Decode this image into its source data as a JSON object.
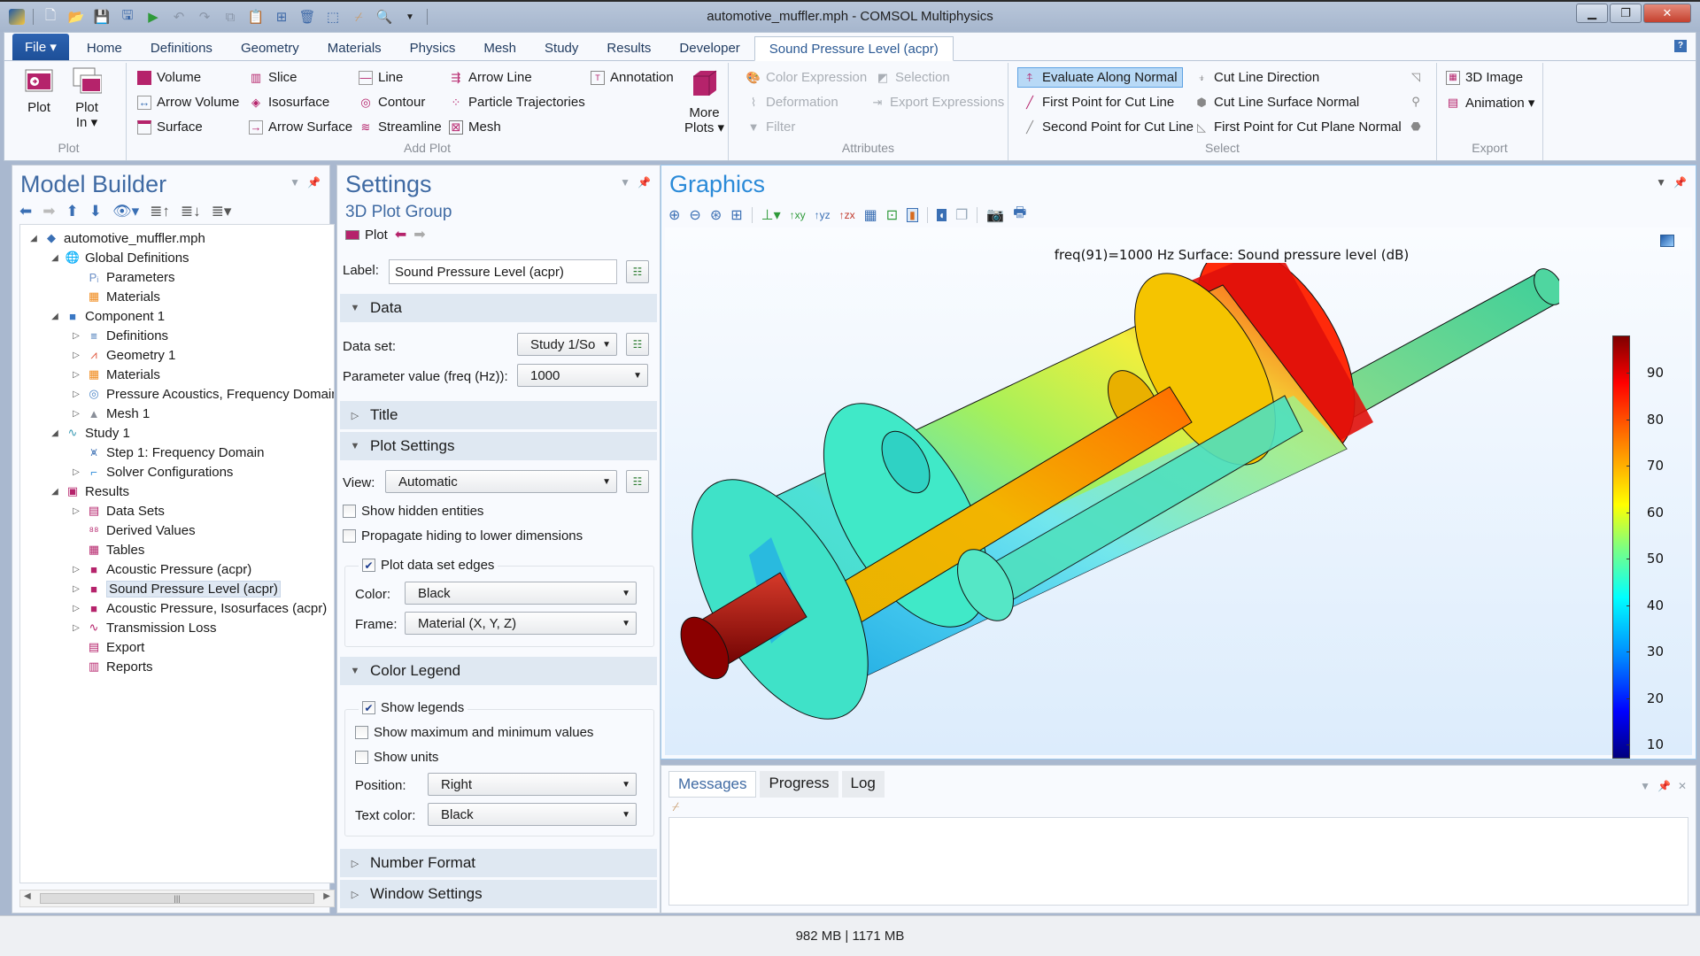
{
  "window": {
    "title": "automotive_muffler.mph - COMSOL Multiphysics",
    "controls": [
      "minimize",
      "maximize",
      "close"
    ]
  },
  "quick_access": [
    "app-logo-icon",
    "new-file-icon",
    "open-folder-icon",
    "save-icon",
    "save-as-icon",
    "run-icon",
    "undo-icon",
    "redo-icon",
    "copy-icon",
    "paste-icon",
    "duplicate-icon",
    "delete-icon",
    "select-icon",
    "clear-selection-icon",
    "find-icon",
    "customize-dropdown-icon"
  ],
  "ribbon": {
    "tabs": [
      "File",
      "Home",
      "Definitions",
      "Geometry",
      "Materials",
      "Physics",
      "Mesh",
      "Study",
      "Results",
      "Developer",
      "Sound Pressure Level (acpr)"
    ],
    "active_tab": "Sound Pressure Level (acpr)",
    "groups": {
      "plot": {
        "label": "Plot",
        "plot": "Plot",
        "plot_in_1": "Plot",
        "plot_in_2": "In ▾"
      },
      "add_plot": {
        "label": "Add Plot",
        "items": [
          "Volume",
          "Arrow Volume",
          "Surface",
          "Slice",
          "Isosurface",
          "Arrow Surface",
          "Line",
          "Contour",
          "Streamline",
          "Arrow Line",
          "Particle Trajectories",
          "Mesh",
          "Annotation"
        ],
        "more_plots_1": "More",
        "more_plots_2": "Plots ▾"
      },
      "attributes": {
        "label": "Attributes",
        "items": [
          "Color Expression",
          "Deformation",
          "Filter",
          "Selection",
          "Export Expressions"
        ]
      },
      "select": {
        "label": "Select",
        "items": [
          "Evaluate Along Normal",
          "First Point for Cut Line",
          "Second Point for Cut Line",
          "Cut Line Direction",
          "Cut Line Surface Normal",
          "First Point for Cut Plane Normal"
        ],
        "selected": "Evaluate Along Normal"
      },
      "export": {
        "label": "Export",
        "items": [
          "3D Image",
          "Animation ▾"
        ]
      }
    }
  },
  "model_builder": {
    "title": "Model Builder",
    "tree": [
      {
        "label": "automotive_muffler.mph",
        "level": 0,
        "toggle": "expanded",
        "icon": "model-icon"
      },
      {
        "label": "Global Definitions",
        "level": 1,
        "toggle": "expanded",
        "icon": "globe-icon"
      },
      {
        "label": "Parameters",
        "level": 2,
        "toggle": "none",
        "icon": "parameters-icon"
      },
      {
        "label": "Materials",
        "level": 2,
        "toggle": "none",
        "icon": "materials-icon"
      },
      {
        "label": "Component 1",
        "level": 1,
        "toggle": "expanded",
        "icon": "component-icon"
      },
      {
        "label": "Definitions",
        "level": 2,
        "toggle": "collapsed",
        "icon": "definitions-icon"
      },
      {
        "label": "Geometry 1",
        "level": 2,
        "toggle": "collapsed",
        "icon": "geometry-icon"
      },
      {
        "label": "Materials",
        "level": 2,
        "toggle": "collapsed",
        "icon": "materials-icon"
      },
      {
        "label": "Pressure Acoustics, Frequency Domain",
        "level": 2,
        "toggle": "collapsed",
        "icon": "acoustics-icon"
      },
      {
        "label": "Mesh 1",
        "level": 2,
        "toggle": "collapsed",
        "icon": "mesh-icon"
      },
      {
        "label": "Study 1",
        "level": 1,
        "toggle": "expanded",
        "icon": "study-icon"
      },
      {
        "label": "Step 1: Frequency Domain",
        "level": 2,
        "toggle": "none",
        "icon": "frequency-step-icon"
      },
      {
        "label": "Solver Configurations",
        "level": 2,
        "toggle": "collapsed",
        "icon": "solver-icon"
      },
      {
        "label": "Results",
        "level": 1,
        "toggle": "expanded",
        "icon": "results-icon"
      },
      {
        "label": "Data Sets",
        "level": 2,
        "toggle": "collapsed",
        "icon": "datasets-icon"
      },
      {
        "label": "Derived Values",
        "level": 2,
        "toggle": "none",
        "icon": "derived-values-icon"
      },
      {
        "label": "Tables",
        "level": 2,
        "toggle": "none",
        "icon": "tables-icon"
      },
      {
        "label": "Acoustic Pressure (acpr)",
        "level": 2,
        "toggle": "collapsed",
        "icon": "plot-group-icon"
      },
      {
        "label": "Sound Pressure Level (acpr)",
        "level": 2,
        "toggle": "collapsed",
        "icon": "plot-group-icon",
        "selected": true
      },
      {
        "label": "Acoustic Pressure, Isosurfaces (acpr)",
        "level": 2,
        "toggle": "collapsed",
        "icon": "plot-group-icon"
      },
      {
        "label": "Transmission Loss",
        "level": 2,
        "toggle": "collapsed",
        "icon": "plot-1d-icon"
      },
      {
        "label": "Export",
        "level": 2,
        "toggle": "none",
        "icon": "export-icon"
      },
      {
        "label": "Reports",
        "level": 2,
        "toggle": "none",
        "icon": "reports-icon"
      }
    ]
  },
  "settings": {
    "title": "Settings",
    "subtitle": "3D Plot Group",
    "plot_button": "Plot",
    "label_field": {
      "label": "Label:",
      "value": "Sound Pressure Level (acpr)"
    },
    "sections": {
      "data": "Data",
      "title": "Title",
      "plot_settings": "Plot Settings",
      "color_legend": "Color Legend",
      "number_format": "Number Format",
      "window_settings": "Window Settings"
    },
    "data": {
      "dataset_label": "Data set:",
      "dataset_value": "Study 1/So",
      "param_label": "Parameter value (freq (Hz)):",
      "param_value": "1000"
    },
    "plot_settings": {
      "view_label": "View:",
      "view_value": "Automatic",
      "show_hidden": {
        "label": "Show hidden entities",
        "checked": false
      },
      "propagate_hiding": {
        "label": "Propagate hiding to lower dimensions",
        "checked": false
      },
      "plot_edges": {
        "label": "Plot data set edges",
        "checked": true
      },
      "color_label": "Color:",
      "color_value": "Black",
      "frame_label": "Frame:",
      "frame_value": "Material  (X, Y, Z)"
    },
    "color_legend": {
      "show_legends": {
        "label": "Show legends",
        "checked": true
      },
      "show_maxmin": {
        "label": "Show maximum and minimum values",
        "checked": false
      },
      "show_units": {
        "label": "Show units",
        "checked": false
      },
      "position_label": "Position:",
      "position_value": "Right",
      "text_color_label": "Text color:",
      "text_color_value": "Black"
    }
  },
  "graphics": {
    "title": "Graphics",
    "caption": "freq(91)=1000 Hz   Surface: Sound pressure level (dB)",
    "legend": {
      "ticks": [
        "90",
        "80",
        "70",
        "60",
        "50",
        "40",
        "30",
        "20",
        "10"
      ],
      "range": [
        7,
        98
      ],
      "colormap": "Rainbow"
    }
  },
  "messages": {
    "tabs": [
      "Messages",
      "Progress",
      "Log"
    ],
    "active_tab": "Messages"
  },
  "status": {
    "memory": "982 MB | 1171 MB"
  },
  "colors": {
    "accent_blue": "#3f6aa3",
    "file_tab": "#2e64b2",
    "magenta_icon": "#b5236b"
  }
}
